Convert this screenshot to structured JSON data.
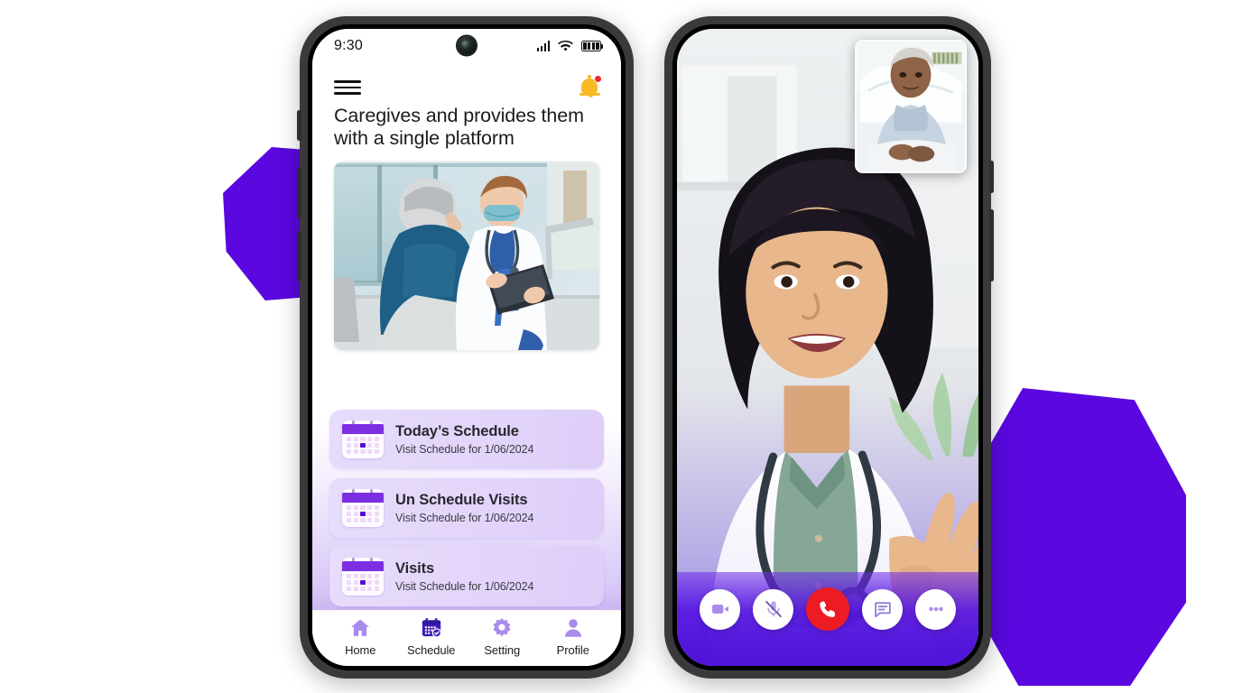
{
  "page": {
    "background": "#ffffff",
    "accent_purple": "#5A08DF",
    "card_purple": "#e3d5fa",
    "end_call_red": "#ED1C24",
    "bell_gold": "#F7B924"
  },
  "decor": {
    "blob_left_name": "purple-blob-left",
    "blob_right_name": "purple-blob-right",
    "blob_color": "#5A08DF"
  },
  "phone_left": {
    "status_bar": {
      "time": "9:30",
      "signal_icon": "cellular-signal-icon",
      "wifi_icon": "wifi-icon",
      "battery_icon": "battery-full-icon"
    },
    "app_bar": {
      "menu_icon": "hamburger-menu-icon",
      "notification_icon": "bell-icon",
      "notification_badge": ""
    },
    "headline": "Caregives and provides them with a single platform",
    "hero_image_alt": "doctor-consulting-elderly-patient",
    "cards": [
      {
        "title": "Today’s Schedule",
        "subtitle": "Visit Schedule for 1/06/2024",
        "icon": "calendar-icon"
      },
      {
        "title": "Un Schedule Visits",
        "subtitle": "Visit Schedule for 1/06/2024",
        "icon": "calendar-icon"
      },
      {
        "title": "Visits",
        "subtitle": "Visit Schedule for 1/06/2024",
        "icon": "calendar-icon"
      }
    ],
    "bottom_nav": [
      {
        "label": "Home",
        "icon": "home-icon",
        "active": false
      },
      {
        "label": "Schedule",
        "icon": "calendar-check-icon",
        "active": true
      },
      {
        "label": "Setting",
        "icon": "gear-icon",
        "active": false
      },
      {
        "label": "Profile",
        "icon": "person-icon",
        "active": false
      }
    ]
  },
  "phone_right": {
    "main_video_alt": "doctor-waving-on-video-call",
    "pip_video_alt": "elderly-patient-in-hospital-bed",
    "call_controls": [
      {
        "name": "video-camera-button",
        "icon": "video-camera-icon",
        "style": "light"
      },
      {
        "name": "mute-microphone-button",
        "icon": "microphone-muted-icon",
        "style": "light"
      },
      {
        "name": "end-call-button",
        "icon": "phone-handset-icon",
        "style": "red"
      },
      {
        "name": "chat-button",
        "icon": "chat-bubble-icon",
        "style": "light"
      },
      {
        "name": "more-options-button",
        "icon": "ellipsis-icon",
        "style": "light"
      }
    ]
  }
}
